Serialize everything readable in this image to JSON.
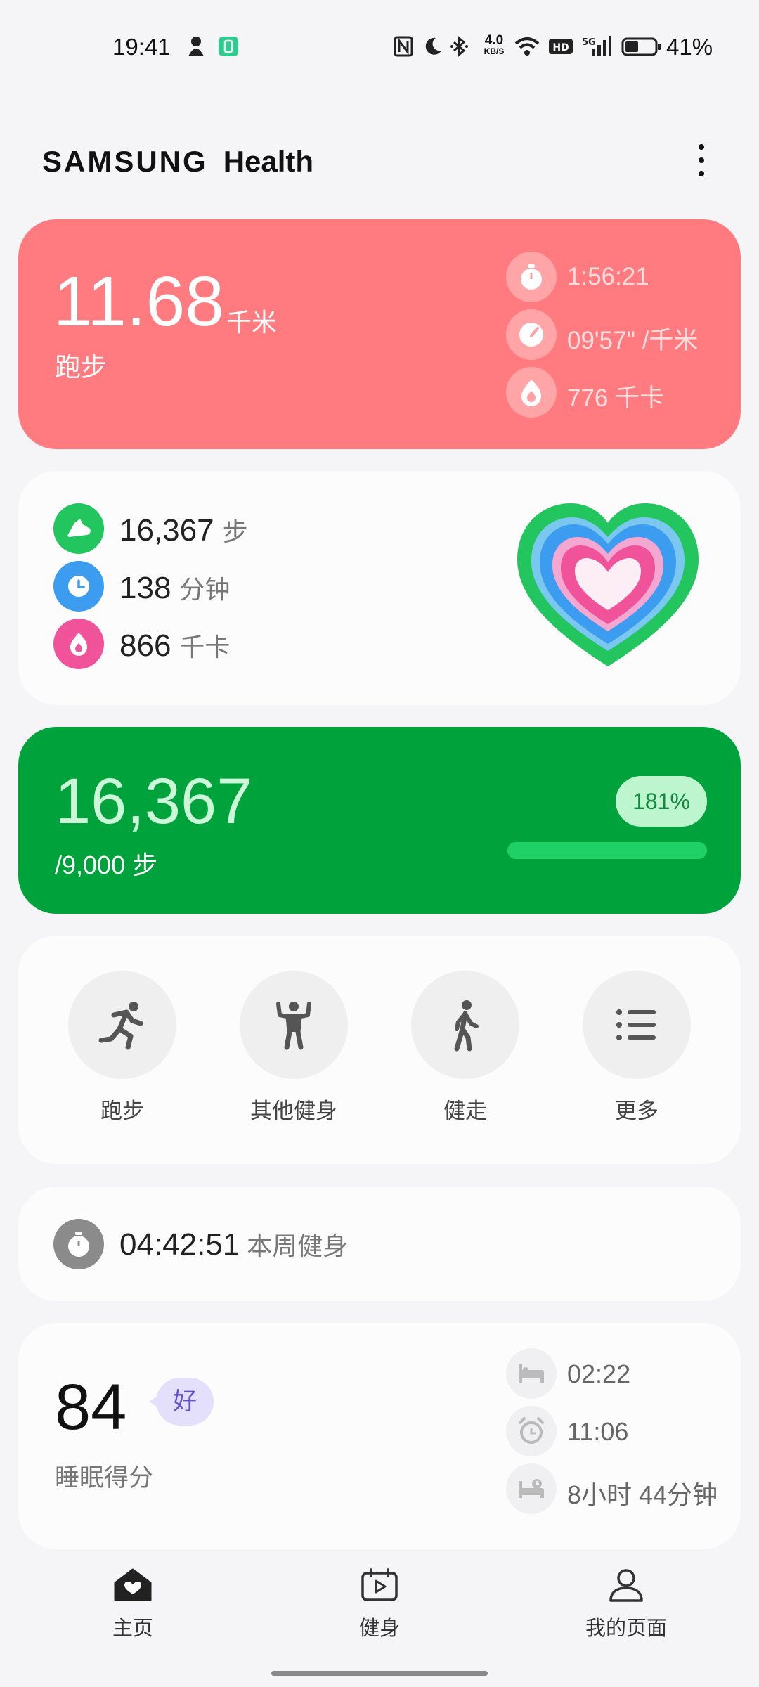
{
  "status_bar": {
    "time": "19:41",
    "net_speed_top": "4.0",
    "net_speed_bottom": "KB/S",
    "battery_percent": "41%",
    "signal": "5G"
  },
  "header": {
    "brand": "SAMSUNG",
    "app": "Health",
    "menu_icon": "more-vertical-icon"
  },
  "running": {
    "distance": "11.68",
    "unit": "千米",
    "label": "跑步",
    "duration": "1:56:21",
    "pace": "09'57\" /千米",
    "calories": "776 千卡"
  },
  "activity": {
    "steps": "16,367",
    "steps_unit": "步",
    "minutes": "138",
    "minutes_unit": "分钟",
    "calories": "866",
    "calories_unit": "千卡",
    "colors": {
      "steps": "#22c55e",
      "minutes": "#3b9cf0",
      "calories": "#f0539a"
    }
  },
  "steps_goal": {
    "value": "16,367",
    "goal": "/9,000 步",
    "percent_label": "181%",
    "progress": 1.0
  },
  "workouts": [
    {
      "label": "跑步",
      "icon": "running-icon"
    },
    {
      "label": "其他健身",
      "icon": "strength-icon"
    },
    {
      "label": "健走",
      "icon": "walking-icon"
    },
    {
      "label": "更多",
      "icon": "list-icon"
    }
  ],
  "weekly": {
    "time": "04:42:51",
    "label": "本周健身"
  },
  "sleep": {
    "score": "84",
    "rating": "好",
    "label": "睡眠得分",
    "bedtime": "02:22",
    "wake": "11:06",
    "duration": "8小时 44分钟"
  },
  "nav": [
    {
      "label": "主页",
      "icon": "home-heart-icon"
    },
    {
      "label": "健身",
      "icon": "fitness-play-icon"
    },
    {
      "label": "我的页面",
      "icon": "person-icon"
    }
  ]
}
